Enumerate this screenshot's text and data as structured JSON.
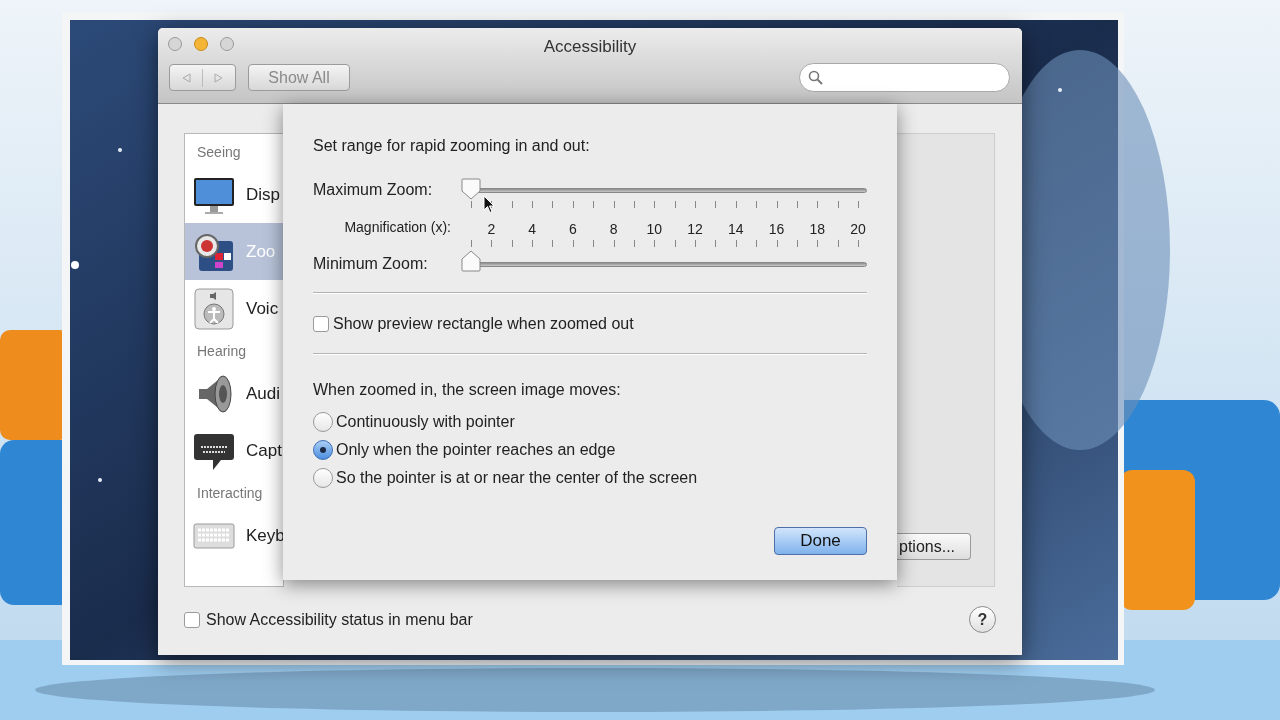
{
  "window": {
    "title": "Accessibility"
  },
  "toolbar": {
    "show_all": "Show All"
  },
  "sidebar": {
    "sections": [
      {
        "heading": "Seeing",
        "items": [
          {
            "label": "Disp",
            "kind": "display",
            "selected": false
          },
          {
            "label": "Zoo",
            "kind": "zoom",
            "selected": true
          },
          {
            "label": "Voic",
            "kind": "voiceover",
            "selected": false
          }
        ]
      },
      {
        "heading": "Hearing",
        "items": [
          {
            "label": "Audi",
            "kind": "audio",
            "selected": false
          },
          {
            "label": "Capt",
            "kind": "captions",
            "selected": false
          }
        ]
      },
      {
        "heading": "Interacting",
        "items": [
          {
            "label": "Keyb",
            "kind": "keyboard",
            "selected": false
          }
        ]
      }
    ]
  },
  "pane": {
    "options_button": "ptions..."
  },
  "sheet": {
    "title": "Set range for rapid zooming in and out:",
    "sliders": [
      {
        "label": "Maximum Zoom:",
        "level": 0
      },
      {
        "label": "Minimum Zoom:",
        "level": 0
      }
    ],
    "scale_label": "Magnification (x):",
    "scale_values": [
      "2",
      "4",
      "6",
      "8",
      "10",
      "12",
      "14",
      "16",
      "18",
      "20"
    ],
    "checkbox": {
      "label": "Show preview rectangle when zoomed out",
      "checked": false
    },
    "move_heading": "When zoomed in, the screen image moves:",
    "move_options": [
      {
        "label": "Continuously with pointer",
        "selected": false
      },
      {
        "label": "Only when the pointer reaches an edge",
        "selected": true
      },
      {
        "label": "So the pointer is at or near the center of the screen",
        "selected": false
      }
    ],
    "done_button": "Done"
  },
  "footer": {
    "status_checkbox": {
      "label": "Show Accessibility status in menu bar",
      "checked": false
    },
    "help": "?"
  }
}
